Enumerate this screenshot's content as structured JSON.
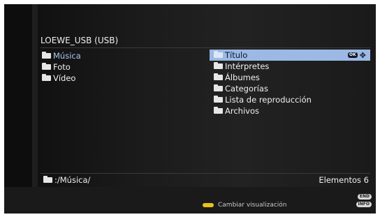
{
  "source": {
    "title": "LOEWE_USB (USB)"
  },
  "left_menu": {
    "items": [
      {
        "label": "Música",
        "active": true
      },
      {
        "label": "Foto",
        "active": false
      },
      {
        "label": "Vídeo",
        "active": false
      }
    ]
  },
  "right_menu": {
    "items": [
      {
        "label": "Título",
        "selected": true
      },
      {
        "label": "Intérpretes"
      },
      {
        "label": "Álbumes"
      },
      {
        "label": "Categorías"
      },
      {
        "label": "Lista de reproducción"
      },
      {
        "label": "Archivos"
      }
    ],
    "selected_icons": {
      "ok": "OK",
      "nav": "✥"
    }
  },
  "status": {
    "path": ":/Música/",
    "count": "Elementos 6"
  },
  "footer": {
    "hint": "Cambiar visualización",
    "hint_key_color": "#e8c21a",
    "end_key": "END",
    "info_key": "INFO"
  },
  "colors": {
    "selected_bg": "#9bb9e4",
    "active_text": "#a9c8f0",
    "background": "#0d0d0d"
  }
}
